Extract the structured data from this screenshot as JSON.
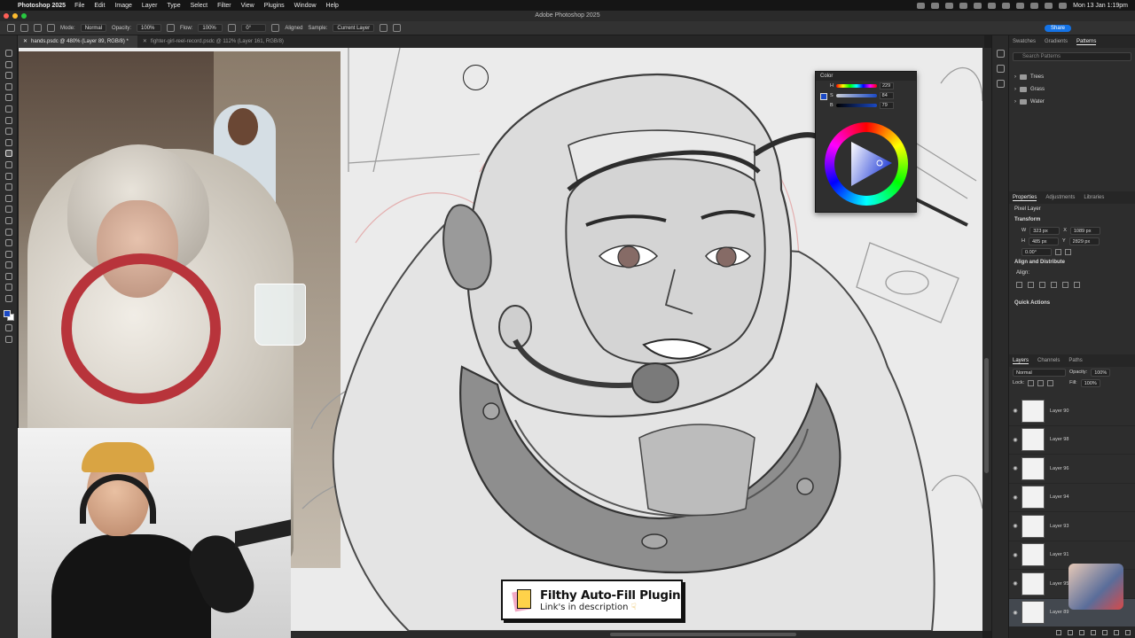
{
  "menubar": {
    "app": "Photoshop 2025",
    "items": [
      "File",
      "Edit",
      "Image",
      "Layer",
      "Type",
      "Select",
      "Filter",
      "View",
      "Plugins",
      "Window",
      "Help"
    ],
    "clock": "Mon 13 Jan 1:19pm"
  },
  "window": {
    "title": "Adobe Photoshop 2025"
  },
  "options": {
    "mode_label": "Mode:",
    "mode_value": "Normal",
    "opacity_label": "Opacity:",
    "opacity_value": "100%",
    "flow_label": "Flow:",
    "flow_value": "100%",
    "angle_value": "0°",
    "aligned_label": "Aligned",
    "sample_label": "Sample:",
    "sample_value": "Current Layer",
    "share_label": "Share"
  },
  "tabs": [
    {
      "label": "hands.psdc @ 480% (Layer 89, RGB/8) *",
      "active": true
    },
    {
      "label": "fighter-girl-reel-record.psdc @ 112% (Layer 161, RGB/8)",
      "active": false
    }
  ],
  "banner": {
    "title": "Filthy Auto-Fill Plugin",
    "subtitle": "Link's in description",
    "hand_icon": "pointing-hand-icon"
  },
  "color_panel": {
    "title": "Color",
    "h_label": "H",
    "h_value": "229",
    "s_label": "S",
    "s_value": "84",
    "b_label": "B",
    "b_value": "79",
    "foreground_color": "#1a49c6"
  },
  "right_panel": {
    "top_tabs": [
      "Swatches",
      "Gradients",
      "Patterns"
    ],
    "search_placeholder": "Search Patterns",
    "folders": [
      "Trees",
      "Grass",
      "Water"
    ],
    "prop_tabs": [
      "Properties",
      "Adjustments",
      "Libraries"
    ],
    "pixel_layer": "Pixel Layer",
    "transform_title": "Transform",
    "w_label": "W",
    "w_value": "323 px",
    "x_label": "X",
    "x_value": "1089 px",
    "h_label": "H",
    "h_value": "485 px",
    "y_label": "Y",
    "y_value": "2829 px",
    "angle_value": "0.00°",
    "align_title": "Align and Distribute",
    "align_label": "Align:",
    "quick_actions": "Quick Actions",
    "layer_tabs": [
      "Layers",
      "Channels",
      "Paths"
    ],
    "blend_mode": "Normal",
    "opacity_label": "Opacity:",
    "opacity_value": "100%",
    "lock_label": "Lock:",
    "fill_label": "Fill:",
    "fill_value": "100%",
    "layers": [
      "Layer 90",
      "Layer 98",
      "Layer 96",
      "Layer 94",
      "Layer 93",
      "Layer 91",
      "Layer 95",
      "Layer 89"
    ]
  }
}
